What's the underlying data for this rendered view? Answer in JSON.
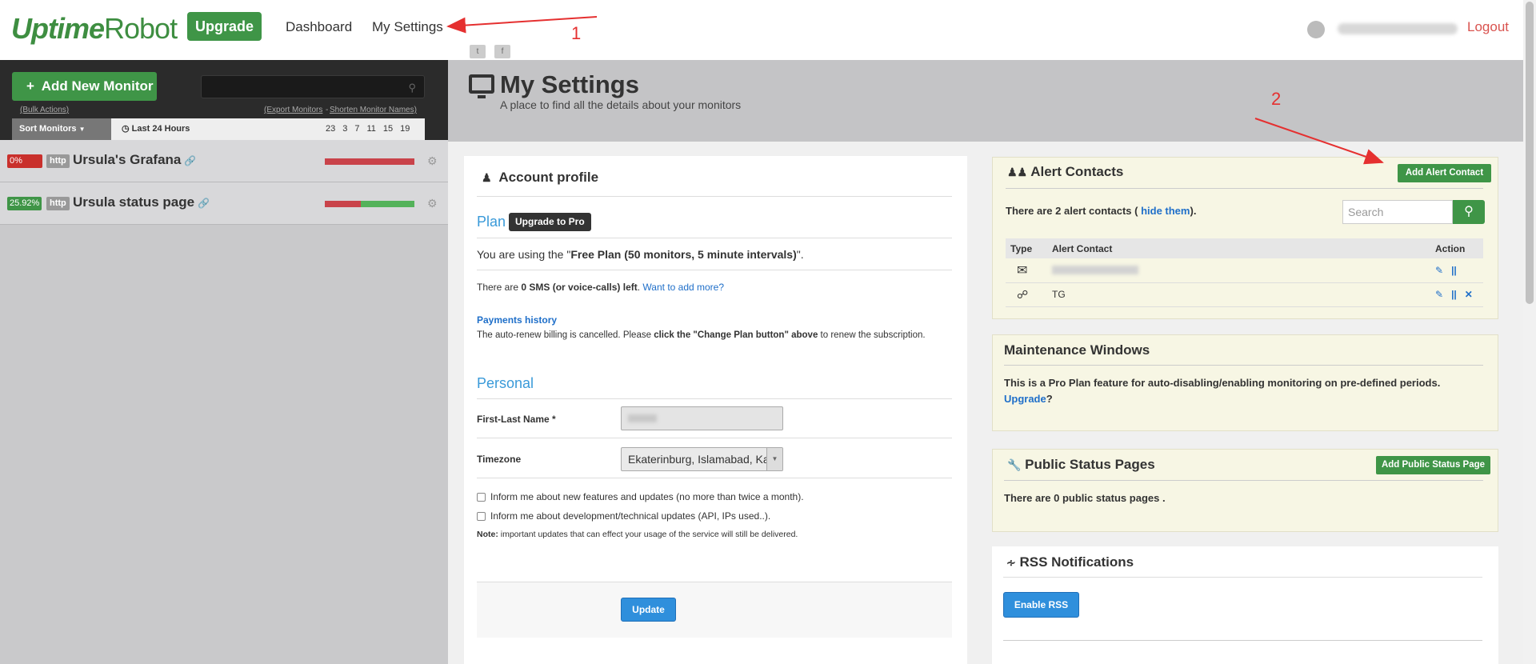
{
  "brand": {
    "logo_bold": "Uptime",
    "logo_light": "Robot"
  },
  "nav": {
    "upgrade": "Upgrade",
    "dashboard": "Dashboard",
    "settings": "My Settings",
    "logout": "Logout"
  },
  "social": {
    "twitter": "t",
    "facebook": "f"
  },
  "sidebar": {
    "add_monitor": "Add New Monitor",
    "bulk_actions": "(Bulk Actions)",
    "export": "(Export Monitors",
    "shorten": "Shorten Monitor Names)",
    "sort": "Sort Monitors",
    "last24": "Last 24 Hours",
    "ticks": [
      "23",
      "3",
      "7",
      "11",
      "15",
      "19"
    ],
    "monitors": [
      {
        "pct": "0%",
        "type": "http",
        "name": "Ursula's Grafana",
        "uptime": 0.0
      },
      {
        "pct": "25.92%",
        "type": "http",
        "name": "Ursula status page",
        "uptime": 0.6
      }
    ]
  },
  "banner": {
    "title": "My Settings",
    "subtitle": "A place to find all the details about your monitors"
  },
  "account": {
    "title": "Account profile",
    "plan_h": "Plan",
    "upgrade_pro": "Upgrade to Pro",
    "plan_pre": "You are using the \"",
    "plan_name": "Free Plan (50 monitors, 5 minute intervals)",
    "plan_post": "\".",
    "sms_pre": "There are ",
    "sms_bold": "0 SMS (or voice-calls) left",
    "sms_post": ". ",
    "sms_link": "Want to add more?",
    "payments": "Payments history",
    "renew_pre": "The auto-renew billing is cancelled. Please ",
    "renew_bold": "click the \"Change Plan button\" above",
    "renew_post": " to renew the subscription.",
    "personal_h": "Personal",
    "name_label": "First-Last Name *",
    "tz_label": "Timezone",
    "tz_value": "Ekaterinburg, Islamabad, Karachi",
    "chk1": "Inform me about new features and updates (no more than twice a month).",
    "chk2": "Inform me about development/technical updates (API, IPs used..).",
    "note_bold": "Note:",
    "note": " important updates that can effect your usage of the service will still be delivered.",
    "update": "Update"
  },
  "alerts": {
    "title": "Alert Contacts",
    "add": "Add Alert Contact",
    "count_pre": "There are 2 alert contacts ( ",
    "hide": "hide them",
    "count_post": ").",
    "search_placeholder": "Search",
    "cols": [
      "Type",
      "Alert Contact",
      "Action"
    ],
    "rows": [
      {
        "icon": "envelope-icon",
        "contact": ""
      },
      {
        "icon": "share-icon",
        "contact": "TG"
      }
    ]
  },
  "maintenance": {
    "title": "Maintenance Windows",
    "text": "This is a Pro Plan feature for auto-disabling/enabling monitoring on pre-defined periods.",
    "link": "Upgrade",
    "q": "?"
  },
  "status_pages": {
    "title": "Public Status Pages",
    "add": "Add Public Status Page",
    "text": "There are 0 public status pages ."
  },
  "rss": {
    "title": "RSS Notifications",
    "button": "Enable RSS"
  },
  "annotations": {
    "n1": "1",
    "n2": "2"
  },
  "colors": {
    "green": "#3f9547",
    "red": "#d9534f",
    "blue": "#2f8fdc",
    "annotation": "#e53030"
  }
}
